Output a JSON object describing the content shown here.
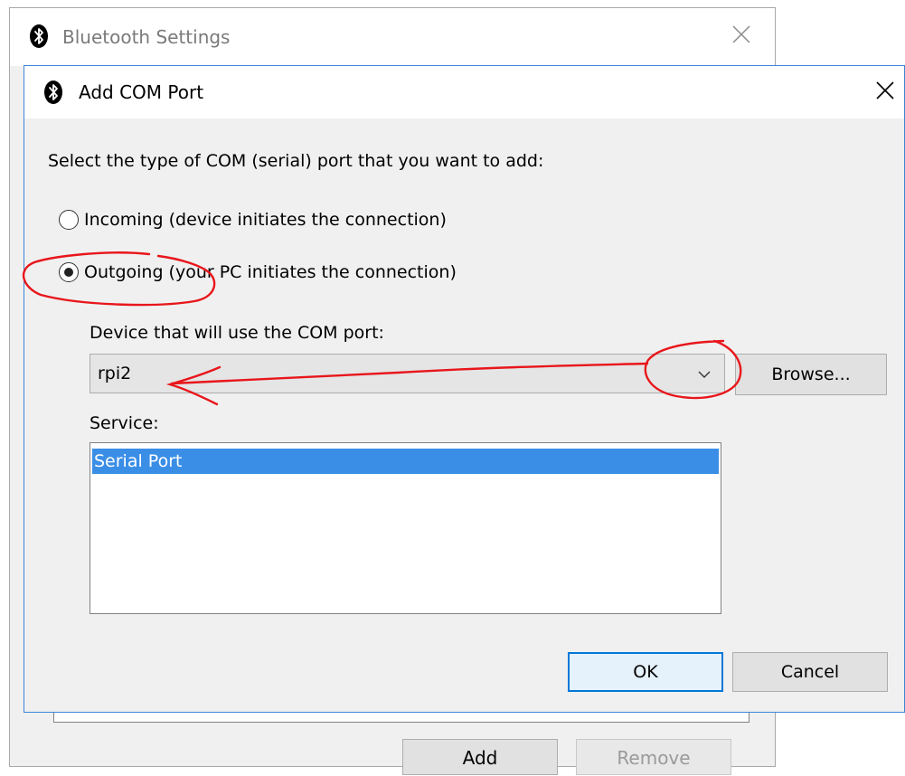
{
  "parent_window": {
    "title": "Bluetooth Settings",
    "buttons": {
      "add_label": "Add",
      "remove_label": "Remove"
    }
  },
  "dialog": {
    "title": "Add COM Port",
    "prompt": "Select the type of COM (serial) port that you want to add:",
    "options": [
      {
        "label": "Incoming (device initiates the connection)",
        "checked": false
      },
      {
        "label": "Outgoing (your PC initiates the connection)",
        "checked": true
      }
    ],
    "device_label": "Device that will use the COM port:",
    "device_value": "rpi2",
    "browse_label": "Browse...",
    "service_label": "Service:",
    "services": [
      "Serial Port"
    ],
    "ok_label": "OK",
    "cancel_label": "Cancel"
  },
  "colors": {
    "accent": "#0078d7",
    "selection": "#3a8ee6",
    "annotation": "#e8161b"
  },
  "icons": {
    "title": "bluetooth-icon",
    "close": "close-icon",
    "dropdown": "chevron-down-icon"
  }
}
